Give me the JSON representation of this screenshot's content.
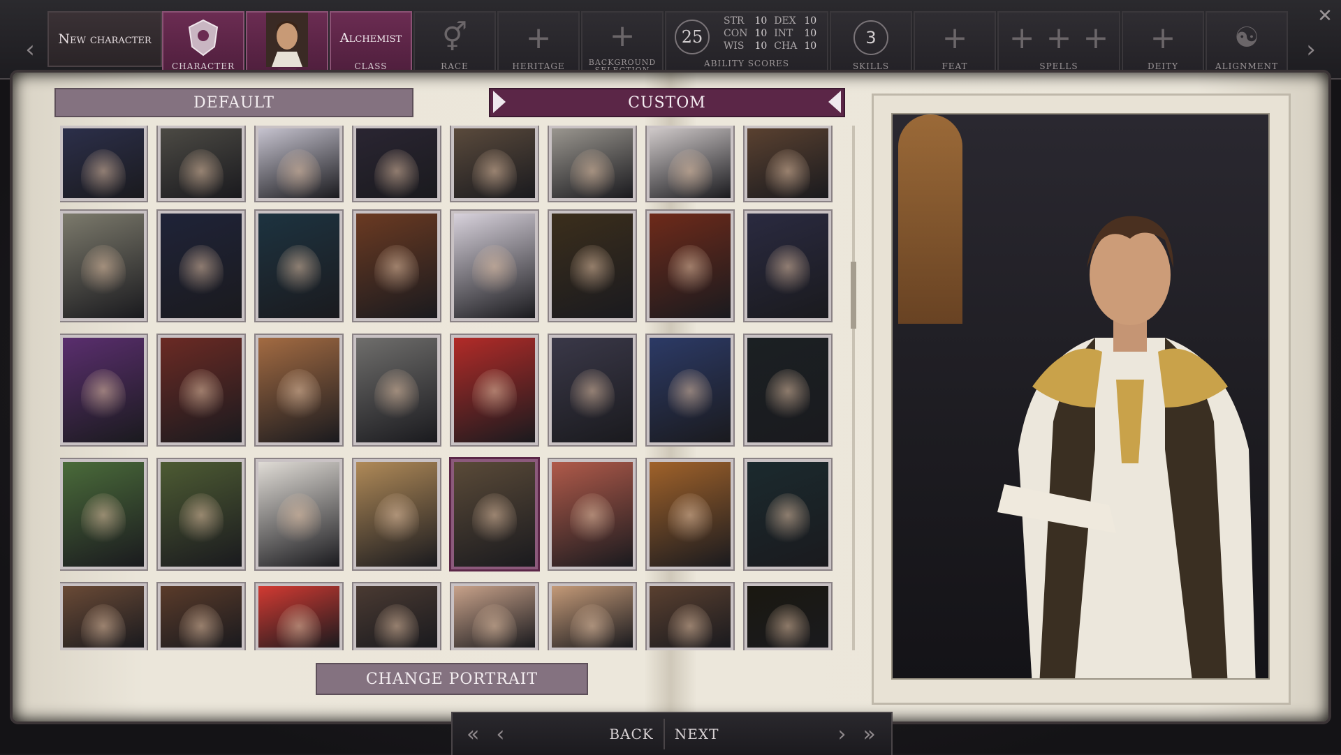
{
  "topbar": {
    "character_name": "New character",
    "steps": [
      {
        "key": "character",
        "caption": "CHARACTER",
        "state": "active"
      },
      {
        "key": "portrait",
        "caption": "",
        "state": "current"
      },
      {
        "key": "class",
        "caption": "CLASS",
        "label": "Alchemist",
        "state": "active"
      },
      {
        "key": "race",
        "caption": "RACE"
      },
      {
        "key": "heritage",
        "caption": "HERITAGE"
      },
      {
        "key": "background",
        "caption": "BACKGROUND SELECTION"
      },
      {
        "key": "ability_scores",
        "caption": "ABILITY SCORES"
      },
      {
        "key": "skills",
        "caption": "SKILLS"
      },
      {
        "key": "feat",
        "caption": "FEAT"
      },
      {
        "key": "spells",
        "caption": "SPELLS"
      },
      {
        "key": "deity",
        "caption": "DEITY"
      },
      {
        "key": "alignment",
        "caption": "ALIGNMENT"
      }
    ],
    "ability_points": "25",
    "scores": {
      "STR": "10",
      "DEX": "10",
      "CON": "10",
      "INT": "10",
      "WIS": "10",
      "CHA": "10"
    },
    "skills_points": "3"
  },
  "tabs": {
    "default": "DEFAULT",
    "custom": "CUSTOM",
    "active": "custom"
  },
  "portraits": {
    "rows": 5,
    "cols": 8,
    "selected": {
      "row": 3,
      "col": 4
    },
    "palette": [
      [
        "#2c2f4a",
        "#4c4a44",
        "#c6c3cf",
        "#2a2532",
        "#5a4a3c",
        "#9a968f",
        "#cfc9c9",
        "#5a4130"
      ],
      [
        "#7c7a6c",
        "#1f2338",
        "#1d3340",
        "#6b3a22",
        "#d8d2dc",
        "#3b2e1c",
        "#6e2a1a",
        "#2a2a40"
      ],
      [
        "#5a2e6e",
        "#6b2a24",
        "#a36b42",
        "#6f6e6c",
        "#b22b28",
        "#3a3848",
        "#2c3a66",
        "#1b2023"
      ],
      [
        "#4a6b3a",
        "#4d5b33",
        "#e0dcd6",
        "#b08a58",
        "#5a4a38",
        "#b05a4a",
        "#a0622a",
        "#1b2a2e"
      ],
      [
        "#6a4a36",
        "#5a3b2a",
        "#d23a32",
        "#4a3a32",
        "#c8a28a",
        "#c49a78",
        "#5a4030",
        "#1a1810"
      ]
    ]
  },
  "buttons": {
    "change_portrait": "CHANGE PORTRAIT",
    "back": "BACK",
    "next": "NEXT"
  },
  "colors": {
    "accent": "#5b2647",
    "paper": "#ece7db",
    "frame": "#1b1a1d"
  }
}
